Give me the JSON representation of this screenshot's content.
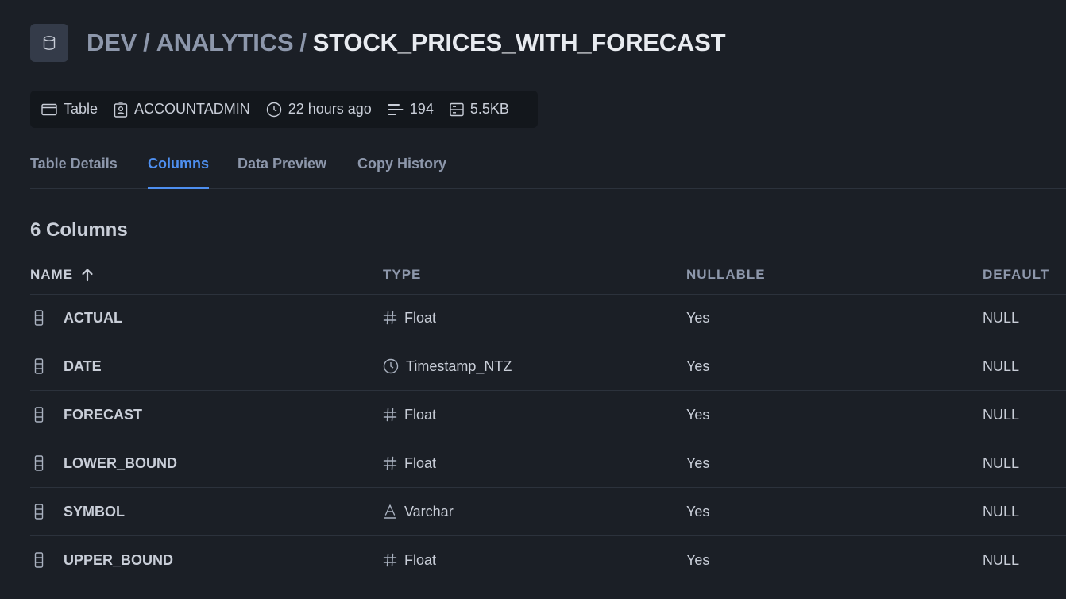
{
  "header": {
    "database": "DEV",
    "separator": "/",
    "schema": "ANALYTICS",
    "table": "STOCK_PRICES_WITH_FORECAST",
    "icon": "database-icon"
  },
  "meta": {
    "kind": "Table",
    "owner": "ACCOUNTADMIN",
    "modified": "22 hours ago",
    "rows": "194",
    "size": "5.5KB"
  },
  "tabs": [
    {
      "label": "Table Details",
      "active": false
    },
    {
      "label": "Columns",
      "active": true
    },
    {
      "label": "Data Preview",
      "active": false
    },
    {
      "label": "Copy History",
      "active": false
    }
  ],
  "column_count": "6 Columns",
  "table": {
    "headers": {
      "name": "NAME",
      "type": "TYPE",
      "nullable": "NULLABLE",
      "default": "DEFAULT"
    },
    "sort": "ascending",
    "rows": [
      {
        "name": "ACTUAL",
        "type": "Float",
        "type_icon": "hash-icon",
        "nullable": "Yes",
        "default": "NULL"
      },
      {
        "name": "DATE",
        "type": "Timestamp_NTZ",
        "type_icon": "clock-icon",
        "nullable": "Yes",
        "default": "NULL"
      },
      {
        "name": "FORECAST",
        "type": "Float",
        "type_icon": "hash-icon",
        "nullable": "Yes",
        "default": "NULL"
      },
      {
        "name": "LOWER_BOUND",
        "type": "Float",
        "type_icon": "hash-icon",
        "nullable": "Yes",
        "default": "NULL"
      },
      {
        "name": "SYMBOL",
        "type": "Varchar",
        "type_icon": "text-icon",
        "nullable": "Yes",
        "default": "NULL"
      },
      {
        "name": "UPPER_BOUND",
        "type": "Float",
        "type_icon": "hash-icon",
        "nullable": "Yes",
        "default": "NULL"
      }
    ]
  },
  "colors": {
    "background": "#1b1f26",
    "accent": "#4e8ff0",
    "muted_text": "#8d97ab",
    "text": "#c9ced8"
  }
}
